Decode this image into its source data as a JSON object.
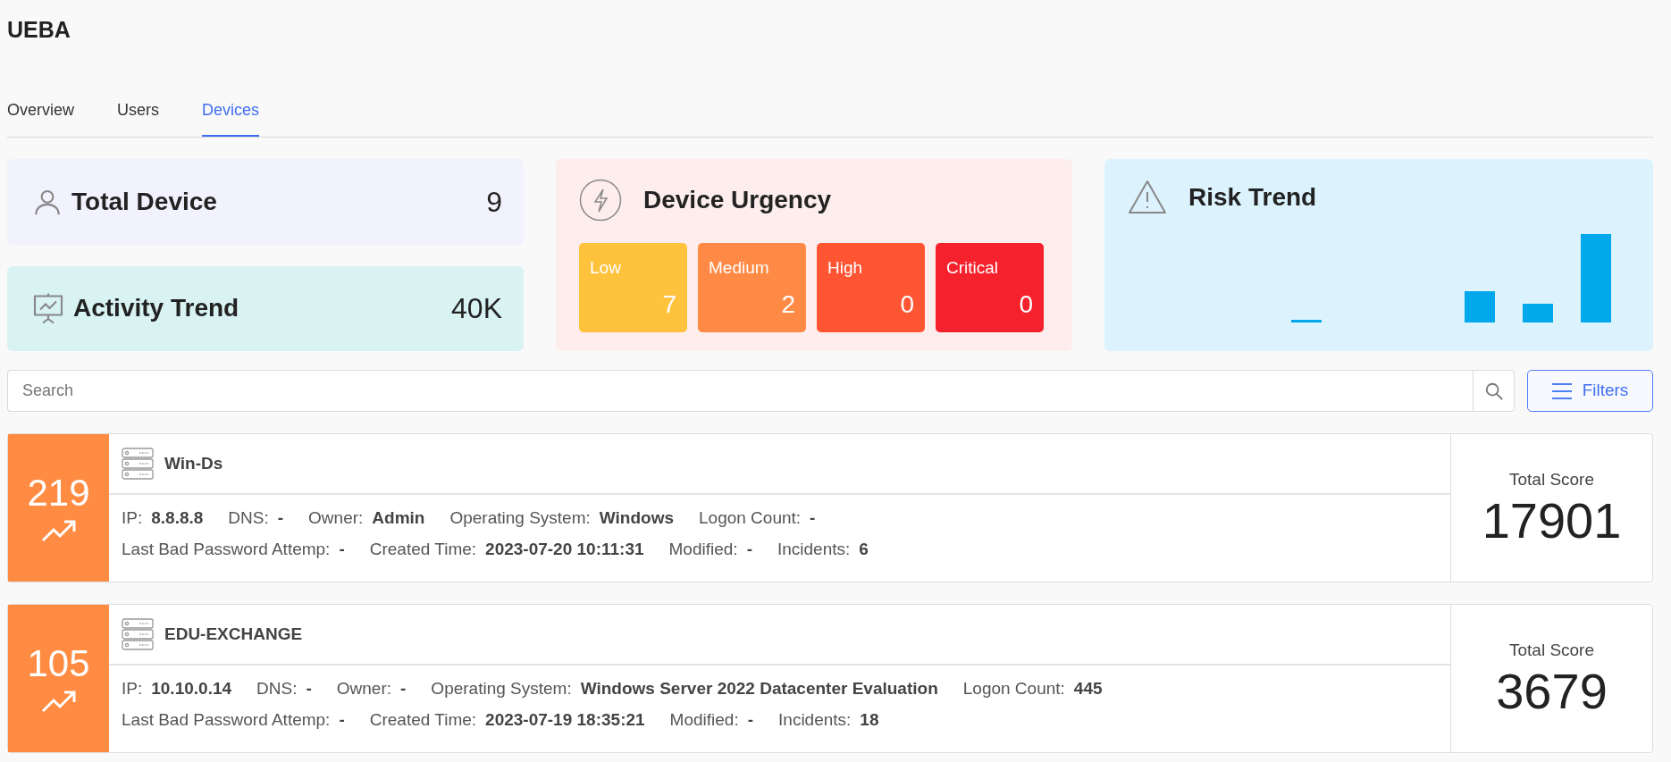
{
  "page_title": "UEBA",
  "tabs": [
    {
      "label": "Overview",
      "selected": false
    },
    {
      "label": "Users",
      "selected": false
    },
    {
      "label": "Devices",
      "selected": true
    }
  ],
  "summary": {
    "total_device": {
      "label": "Total Device",
      "value": "9"
    },
    "activity_trend": {
      "label": "Activity Trend",
      "value": "40K"
    }
  },
  "urgency": {
    "title": "Device Urgency",
    "levels": [
      {
        "label": "Low",
        "value": "7",
        "color": "#ffc23d"
      },
      {
        "label": "Medium",
        "value": "2",
        "color": "#ff8a45"
      },
      {
        "label": "High",
        "value": "0",
        "color": "#ff5533"
      },
      {
        "label": "Critical",
        "value": "0",
        "color": "#f5222d"
      }
    ]
  },
  "risk_trend": {
    "title": "Risk Trend"
  },
  "search": {
    "placeholder": "Search"
  },
  "filters_button": "Filters",
  "devices": [
    {
      "score": "219",
      "name": "Win-Ds",
      "fields": [
        {
          "label": "IP:",
          "value": "8.8.8.8"
        },
        {
          "label": "DNS:",
          "value": "-"
        },
        {
          "label": "Owner:",
          "value": "Admin"
        },
        {
          "label": "Operating System:",
          "value": "Windows"
        },
        {
          "label": "Logon Count:",
          "value": "-"
        }
      ],
      "fields_2": [
        {
          "label": "Last Bad Password Attemp:",
          "value": "-"
        },
        {
          "label": "Created Time:",
          "value": "2023-07-20 10:11:31"
        },
        {
          "label": "Modified:",
          "value": "-"
        },
        {
          "label": "Incidents:",
          "value": "6"
        }
      ],
      "total_label": "Total Score",
      "total": "17901"
    },
    {
      "score": "105",
      "name": "EDU-EXCHANGE",
      "fields": [
        {
          "label": "IP:",
          "value": "10.10.0.14"
        },
        {
          "label": "DNS:",
          "value": "-"
        },
        {
          "label": "Owner:",
          "value": "-"
        },
        {
          "label": "Operating System:",
          "value": "Windows Server 2022 Datacenter Evaluation"
        },
        {
          "label": "Logon Count:",
          "value": "445"
        }
      ],
      "fields_2": [
        {
          "label": "Last Bad Password Attemp:",
          "value": "-"
        },
        {
          "label": "Created Time:",
          "value": "2023-07-19 18:35:21"
        },
        {
          "label": "Modified:",
          "value": "-"
        },
        {
          "label": "Incidents:",
          "value": "18"
        }
      ],
      "total_label": "Total Score",
      "total": "3679"
    }
  ]
}
